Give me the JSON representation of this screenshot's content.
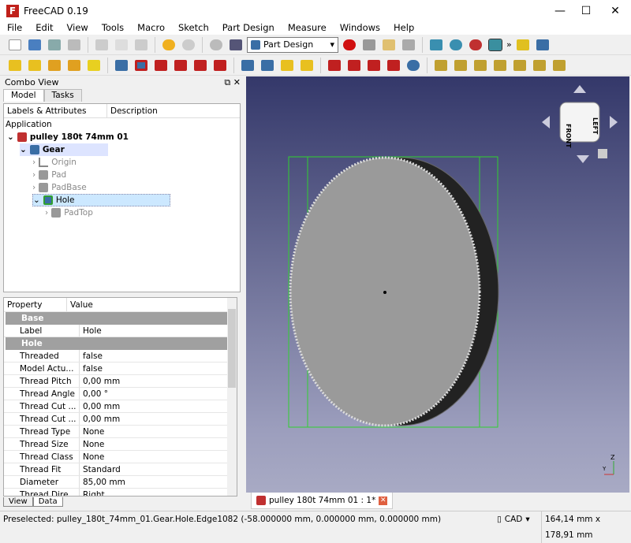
{
  "window": {
    "title": "FreeCAD 0.19",
    "minimize": "—",
    "maximize": "☐",
    "close": "✕"
  },
  "menu": [
    "File",
    "Edit",
    "View",
    "Tools",
    "Macro",
    "Sketch",
    "Part Design",
    "Measure",
    "Windows",
    "Help"
  ],
  "toolbar": {
    "workbench": "Part Design",
    "overflow": "»"
  },
  "combo": {
    "title": "Combo View",
    "tabs": [
      "Model",
      "Tasks"
    ],
    "tree": {
      "columns": [
        "Labels & Attributes",
        "Description"
      ],
      "root": "Application",
      "document": "pulley 180t 74mm 01",
      "body": "Gear",
      "items": [
        "Origin",
        "Pad",
        "PadBase",
        "Hole",
        "PadTop"
      ]
    },
    "properties": {
      "columns": [
        "Property",
        "Value"
      ],
      "groups": [
        "Base",
        "Hole"
      ],
      "base": [
        {
          "k": "Label",
          "v": "Hole"
        }
      ],
      "hole": [
        {
          "k": "Threaded",
          "v": "false"
        },
        {
          "k": "Model Actu...",
          "v": "false"
        },
        {
          "k": "Thread Pitch",
          "v": "0,00 mm"
        },
        {
          "k": "Thread Angle",
          "v": "0,00 °"
        },
        {
          "k": "Thread Cut ...",
          "v": "0,00 mm"
        },
        {
          "k": "Thread Cut ...",
          "v": "0,00 mm"
        },
        {
          "k": "Thread Type",
          "v": "None"
        },
        {
          "k": "Thread Size",
          "v": "None"
        },
        {
          "k": "Thread Class",
          "v": "None"
        },
        {
          "k": "Thread Fit",
          "v": "Standard"
        },
        {
          "k": "Diameter",
          "v": "85,00 mm"
        },
        {
          "k": "Thread Dire...",
          "v": "Right"
        }
      ]
    },
    "bottom_tabs": [
      "View",
      "Data"
    ]
  },
  "navcube": {
    "front": "FRONT",
    "left": "LEFT"
  },
  "doc_tab": "pulley 180t 74mm 01 : 1*",
  "status": {
    "message": "Preselected: pulley_180t_74mm_01.Gear.Hole.Edge1082 (-58.000000 mm, 0.000000 mm, 0.000000 mm)",
    "nav": "CAD",
    "dimensions": "164,14 mm x 178,91 mm"
  }
}
